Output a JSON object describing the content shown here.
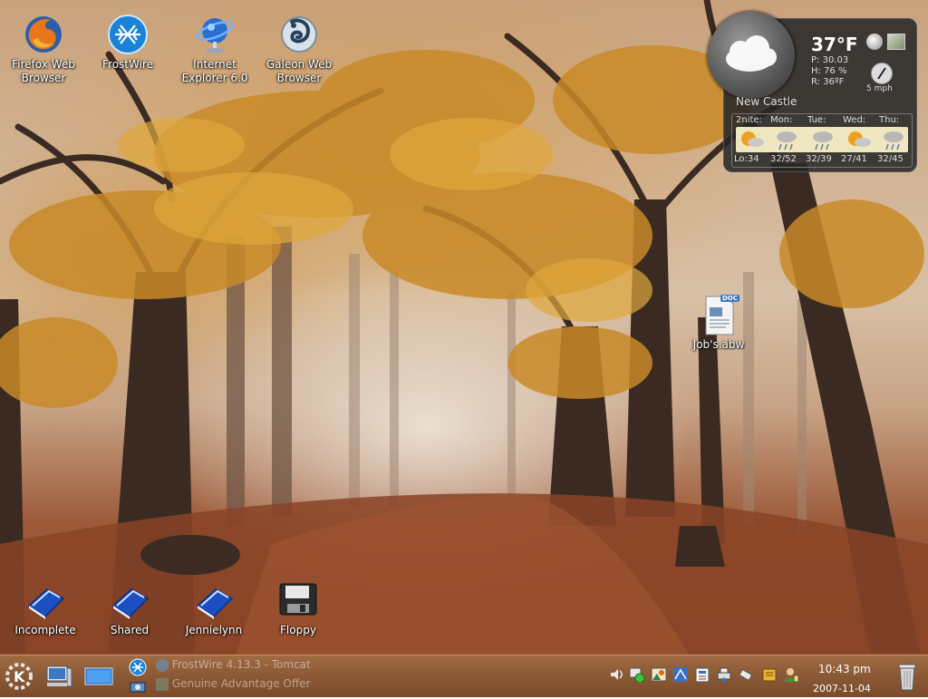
{
  "desktop": {
    "top_icons": [
      {
        "label": "Firefox Web Browser"
      },
      {
        "label": "FrostWire"
      },
      {
        "label": "Internet Explorer 6.0"
      },
      {
        "label": "Galeon Web Browser"
      }
    ],
    "bottom_icons": [
      {
        "label": "Incomplete"
      },
      {
        "label": "Shared"
      },
      {
        "label": "Jennielynn"
      },
      {
        "label": "Floppy"
      }
    ],
    "file_icon": {
      "label": "Job's.abw",
      "badge": "DOC"
    }
  },
  "weather": {
    "temperature": "37°F",
    "pressure": "P: 30.03",
    "humidity": "H: 76 %",
    "real_feel": "R: 36ºF",
    "wind": "5 mph",
    "city": "New Castle",
    "days": [
      "2nite:",
      "Mon:",
      "Tue:",
      "Wed:",
      "Thu:"
    ],
    "lows_highs": [
      "Lo:34",
      "32/52",
      "32/39",
      "27/41",
      "32/45"
    ]
  },
  "taskbar": {
    "tasks": [
      {
        "label": "FrostWire 4.13.3 - Tomcat"
      },
      {
        "label": "Genuine Advantage Offer"
      }
    ],
    "clock_time": "10:43 pm",
    "clock_date": "2007-11-04"
  },
  "colors": {
    "taskbar": "#8c5a36",
    "widget_bg": "#282828",
    "forecast_strip": "#efe7bf"
  }
}
